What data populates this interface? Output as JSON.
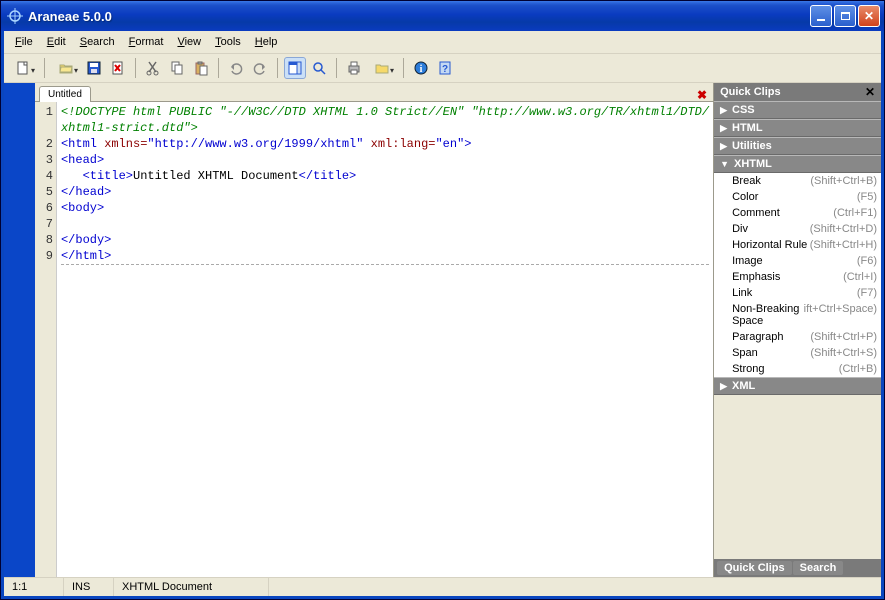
{
  "title": "Araneae 5.0.0",
  "menu": [
    "File",
    "Edit",
    "Search",
    "Format",
    "View",
    "Tools",
    "Help"
  ],
  "tabs": {
    "active": "Untitled"
  },
  "editor": {
    "lines": [
      {
        "n": "1",
        "parts": [
          {
            "cls": "c-comment",
            "t": "<!DOCTYPE html PUBLIC \"-//W3C//DTD XHTML 1.0 Strict//EN\" \"http://www.w3.org/TR/xhtml1/DTD/"
          }
        ]
      },
      {
        "n": "",
        "parts": [
          {
            "cls": "c-comment",
            "t": "xhtml1-strict.dtd\">"
          }
        ]
      },
      {
        "n": "2",
        "parts": [
          {
            "cls": "c-tag",
            "t": "<html "
          },
          {
            "cls": "c-attr",
            "t": "xmlns="
          },
          {
            "cls": "c-val",
            "t": "\"http://www.w3.org/1999/xhtml\""
          },
          {
            "cls": "c-tag",
            "t": " "
          },
          {
            "cls": "c-attr",
            "t": "xml:lang="
          },
          {
            "cls": "c-val",
            "t": "\"en\""
          },
          {
            "cls": "c-tag",
            "t": ">"
          }
        ]
      },
      {
        "n": "3",
        "parts": [
          {
            "cls": "c-tag",
            "t": "<head>"
          }
        ]
      },
      {
        "n": "4",
        "parts": [
          {
            "cls": "c-text",
            "t": "   "
          },
          {
            "cls": "c-tag",
            "t": "<title>"
          },
          {
            "cls": "c-text",
            "t": "Untitled XHTML Document"
          },
          {
            "cls": "c-tag",
            "t": "</title>"
          }
        ]
      },
      {
        "n": "5",
        "parts": [
          {
            "cls": "c-tag",
            "t": "</head>"
          }
        ]
      },
      {
        "n": "6",
        "parts": [
          {
            "cls": "c-tag",
            "t": "<body>"
          }
        ]
      },
      {
        "n": "7",
        "parts": [
          {
            "cls": "c-text",
            "t": ""
          }
        ]
      },
      {
        "n": "8",
        "parts": [
          {
            "cls": "c-tag",
            "t": "</body>"
          }
        ]
      },
      {
        "n": "9",
        "parts": [
          {
            "cls": "c-tag",
            "t": "</html>"
          }
        ]
      }
    ]
  },
  "sidebar": {
    "title": "Quick Clips",
    "sections": [
      {
        "label": "CSS",
        "expanded": false
      },
      {
        "label": "HTML",
        "expanded": false
      },
      {
        "label": "Utilities",
        "expanded": false
      },
      {
        "label": "XHTML",
        "expanded": true,
        "items": [
          {
            "label": "Break",
            "shortcut": "(Shift+Ctrl+B)"
          },
          {
            "label": "Color",
            "shortcut": "(F5)"
          },
          {
            "label": "Comment",
            "shortcut": "(Ctrl+F1)"
          },
          {
            "label": "Div",
            "shortcut": "(Shift+Ctrl+D)"
          },
          {
            "label": "Horizontal Rule",
            "shortcut": "(Shift+Ctrl+H)"
          },
          {
            "label": "Image",
            "shortcut": "(F6)"
          },
          {
            "label": "Emphasis",
            "shortcut": "(Ctrl+I)"
          },
          {
            "label": "Link",
            "shortcut": "(F7)"
          },
          {
            "label": "Non-Breaking Space",
            "shortcut": "ift+Ctrl+Space)"
          },
          {
            "label": "Paragraph",
            "shortcut": "(Shift+Ctrl+P)"
          },
          {
            "label": "Span",
            "shortcut": "(Shift+Ctrl+S)"
          },
          {
            "label": "Strong",
            "shortcut": "(Ctrl+B)"
          }
        ]
      },
      {
        "label": "XML",
        "expanded": false
      }
    ],
    "bottom_tabs": [
      "Quick Clips",
      "Search"
    ]
  },
  "status": {
    "pos": "1:1",
    "mode": "INS",
    "doc_type": "XHTML Document"
  }
}
